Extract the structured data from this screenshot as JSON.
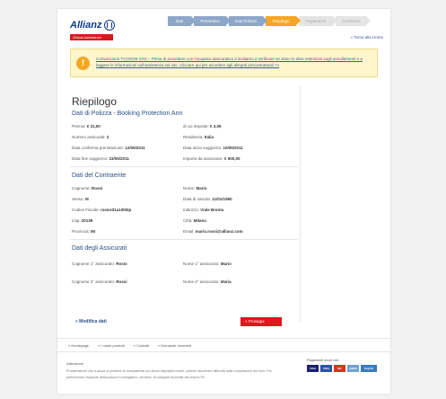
{
  "header": {
    "logo_text": "Allianz",
    "sub_brand": "Global Assistance",
    "home_link": "« Torna alla Home",
    "steps": [
      {
        "label": "Dati",
        "state": "done"
      },
      {
        "label": "Preventivo",
        "state": "done"
      },
      {
        "label": "Dati Polizza",
        "state": "done"
      },
      {
        "label": "Riepilogo",
        "state": "active"
      },
      {
        "label": "Pagamento",
        "state": "todo"
      },
      {
        "label": "Conferma",
        "state": "todo"
      }
    ]
  },
  "notice": {
    "icon": "exclamation-icon",
    "text": "Convenzione TCOOO8 XXX – Prima di procedere con l'acquisto assicurativo ti invitiamo a verificare se siano le altre restrizioni sugli annullamenti e a leggere le informazioni sull'assistenza sul sito. Cliccare qui per accedere agli allegati precontrattuali >>"
  },
  "summary": {
    "title": "Riepilogo",
    "policy": {
      "title": "Dati di Polizza - Booking Protection Ann",
      "left": [
        {
          "label": "Premio:",
          "value": "€ 31,00"
        },
        {
          "label": "Numero assicurati:",
          "value": "2"
        },
        {
          "label": "Data conferma prenotazione:",
          "value": "12/05/2011"
        },
        {
          "label": "Data fine soggiorno:",
          "value": "23/05/2011"
        }
      ],
      "right": [
        {
          "label": "di cui imposte:",
          "value": "€ 3,09"
        },
        {
          "label": "Residenza:",
          "value": "Italia"
        },
        {
          "label": "Data inizio soggiorno:",
          "value": "10/05/2011"
        },
        {
          "label": "Importo da assicurare:",
          "value": "€ 500,00"
        }
      ]
    },
    "contractor": {
      "title": "Dati del Contraente",
      "left": [
        {
          "label": "Cognome:",
          "value": "Rossi"
        },
        {
          "label": "Sesso:",
          "value": "M"
        },
        {
          "label": "Codice Fiscale:",
          "value": "rssmrd1a10l00p"
        },
        {
          "label": "Cap:",
          "value": "20139"
        },
        {
          "label": "Provincia:",
          "value": "MI"
        }
      ],
      "right": [
        {
          "label": "Nome:",
          "value": "Mario"
        },
        {
          "label": "Data di nascita:",
          "value": "11/01/1990"
        },
        {
          "label": "Indirizzo:",
          "value": "Viale Brenta"
        },
        {
          "label": "Città:",
          "value": "Milano"
        },
        {
          "label": "Email:",
          "value": "mario.rossi@allianz.com"
        }
      ]
    },
    "insured": {
      "title": "Dati degli Assicurati",
      "left": [
        {
          "label": "Cognome 1° assicurato:",
          "value": "Rossi"
        },
        {
          "label": "Cognome 2° assicurato:",
          "value": "Rossi"
        }
      ],
      "right": [
        {
          "label": "Nome 1° assicurato:",
          "value": "Mario"
        },
        {
          "label": "Nome 2° assicurato:",
          "value": "Maria"
        }
      ]
    },
    "modify_label": "« Modifica dati",
    "proceed_label": "» Prosegui"
  },
  "footer": {
    "links": [
      "» Homepage",
      "» I nostri prodotti",
      "» Contatti",
      "» Domande ricorrenti"
    ],
    "attention_title": "Attenzione",
    "attention_text": "Problematiche che a causa di problemi di compatibilità con alcuni dispositivi mobili, potresti riscontrare difficoltà nella compilazione del form. Per perfezionare l'acquisto della polizza ti consigliamo, pertanto, di collegarti al portale dal proprio PC.",
    "payments_title": "Pagamenti sicuri con:",
    "cards": [
      {
        "label": "VISA",
        "color": "#1a1f71"
      },
      {
        "label": "VISA",
        "color": "#2b55a5"
      },
      {
        "label": "MC",
        "color": "#e0311f"
      },
      {
        "label": "AMEX",
        "color": "#6fa2d6"
      },
      {
        "label": "PayPal",
        "color": "#3b7bbf"
      }
    ]
  }
}
